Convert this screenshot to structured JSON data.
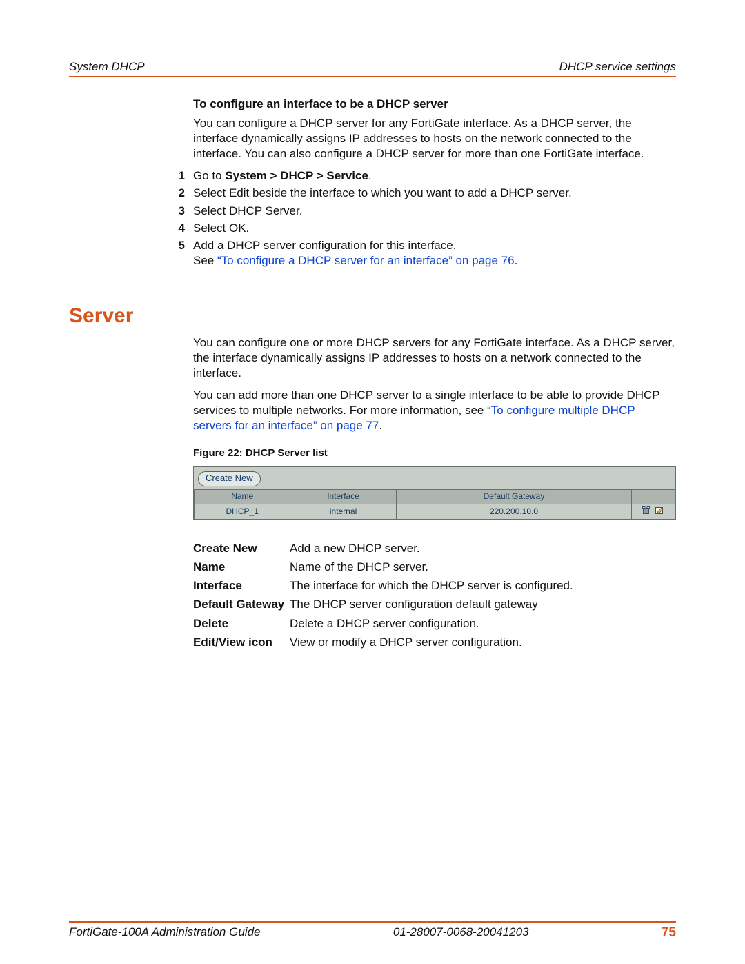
{
  "header": {
    "left": "System DHCP",
    "right": "DHCP service settings"
  },
  "intro": {
    "heading": "To configure an interface to be a DHCP server",
    "paragraph": "You can configure a DHCP server for any FortiGate interface. As a DHCP server, the interface dynamically assigns IP addresses to hosts on the network connected to the interface. You can also configure a DHCP server for more than one FortiGate interface."
  },
  "steps": [
    {
      "n": "1",
      "pre": "Go to ",
      "bold": "System > DHCP > Service",
      "post": "."
    },
    {
      "n": "2",
      "text": "Select Edit beside the interface to which you want to add a DHCP server."
    },
    {
      "n": "3",
      "text": "Select DHCP Server."
    },
    {
      "n": "4",
      "text": "Select OK."
    },
    {
      "n": "5",
      "text": "Add a DHCP server configuration for this interface.",
      "see_prefix": "See ",
      "see_link": "“To configure a DHCP server for an interface” on page 76",
      "see_suffix": "."
    }
  ],
  "section": {
    "title": "Server",
    "p1": "You can configure one or more DHCP servers for any FortiGate interface. As a DHCP server, the interface dynamically assigns IP addresses to hosts on a network connected to the interface.",
    "p2_pre": "You can add more than one DHCP server to a single interface to be able to provide DHCP services to multiple networks. For more information, see ",
    "p2_link": "“To configure multiple DHCP servers for an interface” on page 77",
    "p2_post": "."
  },
  "figure": {
    "caption": "Figure 22: DHCP Server list",
    "create_new_label": "Create New",
    "headers": {
      "name": "Name",
      "interface": "Interface",
      "gateway": "Default Gateway",
      "actions": ""
    },
    "row": {
      "name": "DHCP_1",
      "interface": "internal",
      "gateway": "220.200.10.0"
    }
  },
  "defs": [
    {
      "term": "Create New",
      "val": "Add a new DHCP server."
    },
    {
      "term": "Name",
      "val": "Name of the DHCP server."
    },
    {
      "term": "Interface",
      "val": "The interface for which the DHCP server is configured."
    },
    {
      "term": "Default Gateway",
      "val": "The DHCP server configuration default gateway"
    },
    {
      "term": "Delete",
      "val": "Delete a DHCP server configuration."
    },
    {
      "term": "Edit/View icon",
      "val": "View or modify a DHCP server configuration."
    }
  ],
  "footer": {
    "left": "FortiGate-100A Administration Guide",
    "mid": "01-28007-0068-20041203",
    "page": "75"
  }
}
